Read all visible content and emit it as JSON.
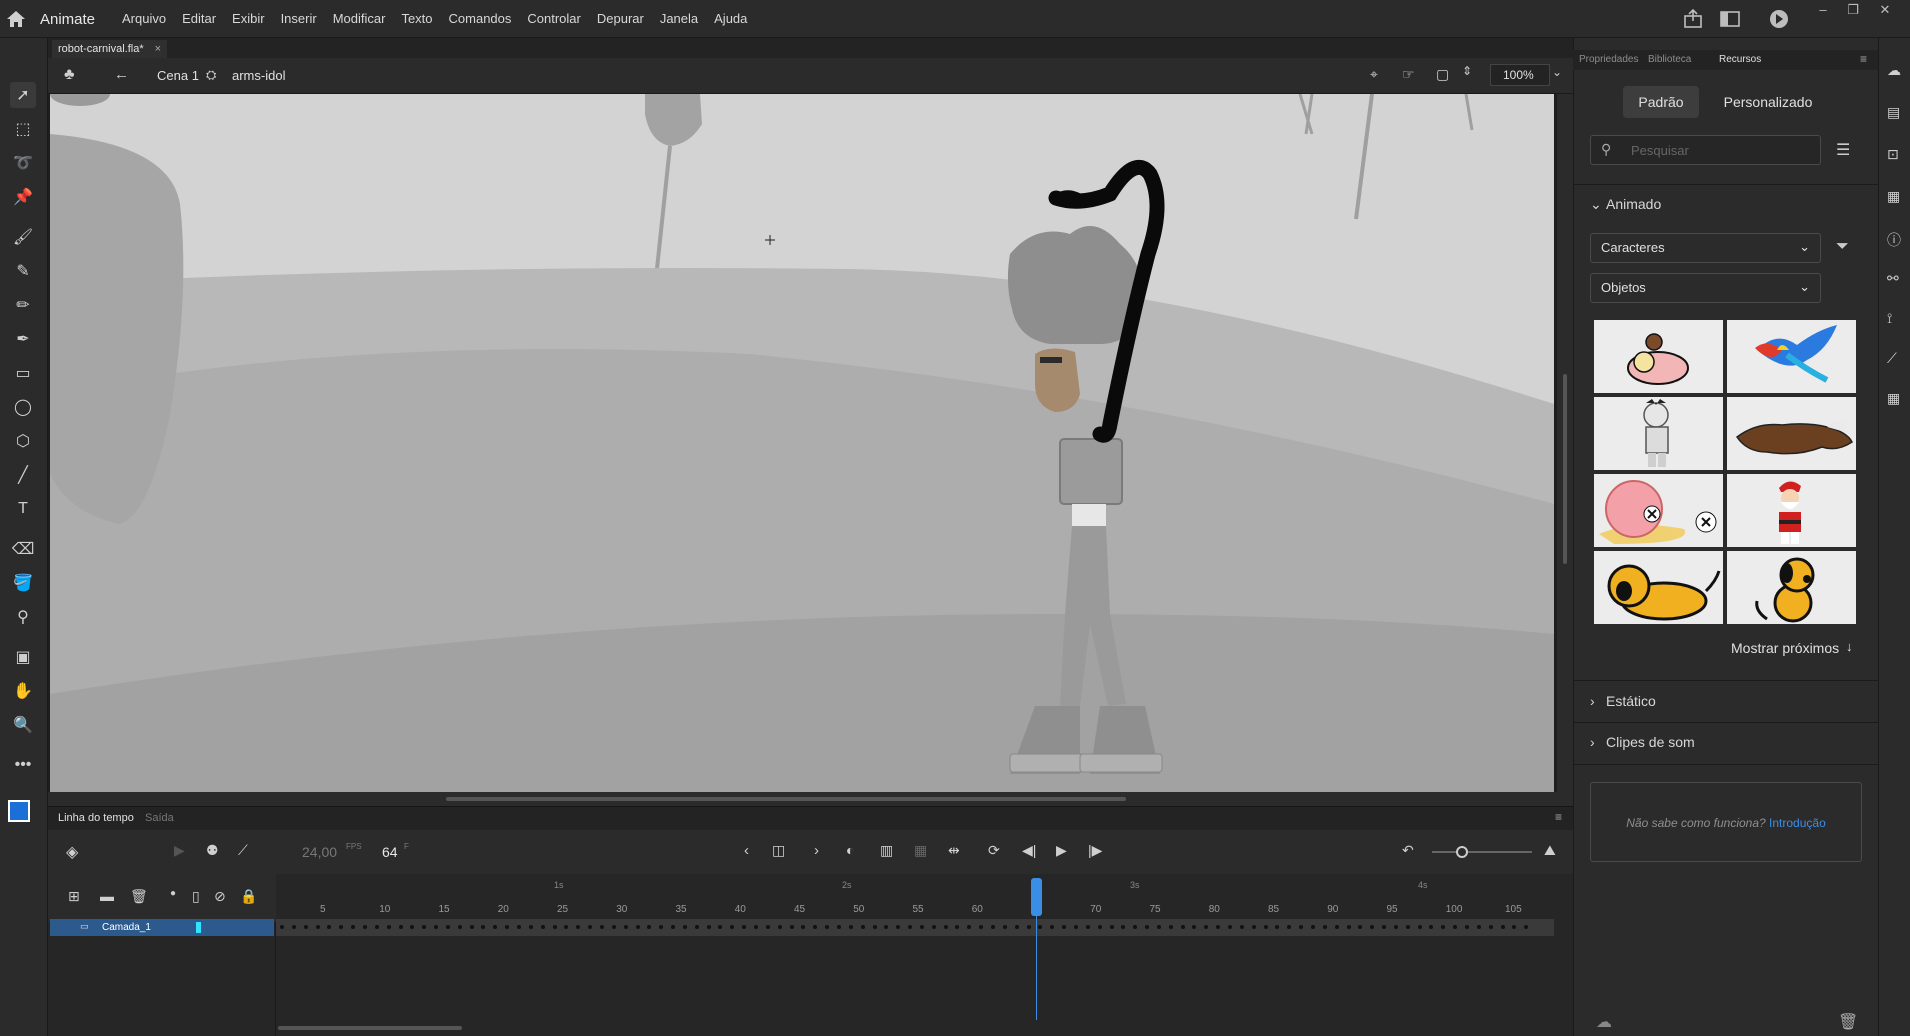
{
  "app": {
    "name": "Animate",
    "menus": [
      "Arquivo",
      "Editar",
      "Exibir",
      "Inserir",
      "Modificar",
      "Texto",
      "Comandos",
      "Controlar",
      "Depurar",
      "Janela",
      "Ajuda"
    ]
  },
  "document": {
    "tab_title": "robot-carnival.fla*",
    "close_glyph": "×"
  },
  "scene_bar": {
    "scene": "Cena 1",
    "symbol": "arms-idol",
    "zoom": "100%"
  },
  "timeline": {
    "tabs": [
      "Linha do tempo",
      "Saída"
    ],
    "fps": "24,00",
    "fps_unit": "FPS",
    "current_frame": "64",
    "frame_unit": "F",
    "seconds_markers": [
      "1s",
      "2s",
      "3s",
      "4s"
    ],
    "frame_numbers": [
      "5",
      "10",
      "15",
      "20",
      "25",
      "30",
      "35",
      "40",
      "45",
      "50",
      "55",
      "60",
      "65",
      "70",
      "75",
      "80",
      "85",
      "90",
      "95",
      "100",
      "105"
    ],
    "layer_name": "Camada_1"
  },
  "right_panel": {
    "tabs": [
      "Propriedades",
      "Biblioteca",
      "Recursos"
    ],
    "active_tab": "Recursos",
    "segment_default": "Padrão",
    "segment_custom": "Personalizado",
    "search_placeholder": "Pesquisar",
    "section_animated": "Animado",
    "dropdown_characters": "Caracteres",
    "dropdown_objects": "Objetos",
    "show_more": "Mostrar próximos",
    "section_static": "Estático",
    "section_sound": "Clipes de som",
    "help_text": "Não sabe como funciona?",
    "help_link": "Introdução"
  },
  "colors": {
    "accent": "#3a8ee6",
    "stroke_color": "#1b6fd6",
    "fill_color": "#ffffff"
  }
}
